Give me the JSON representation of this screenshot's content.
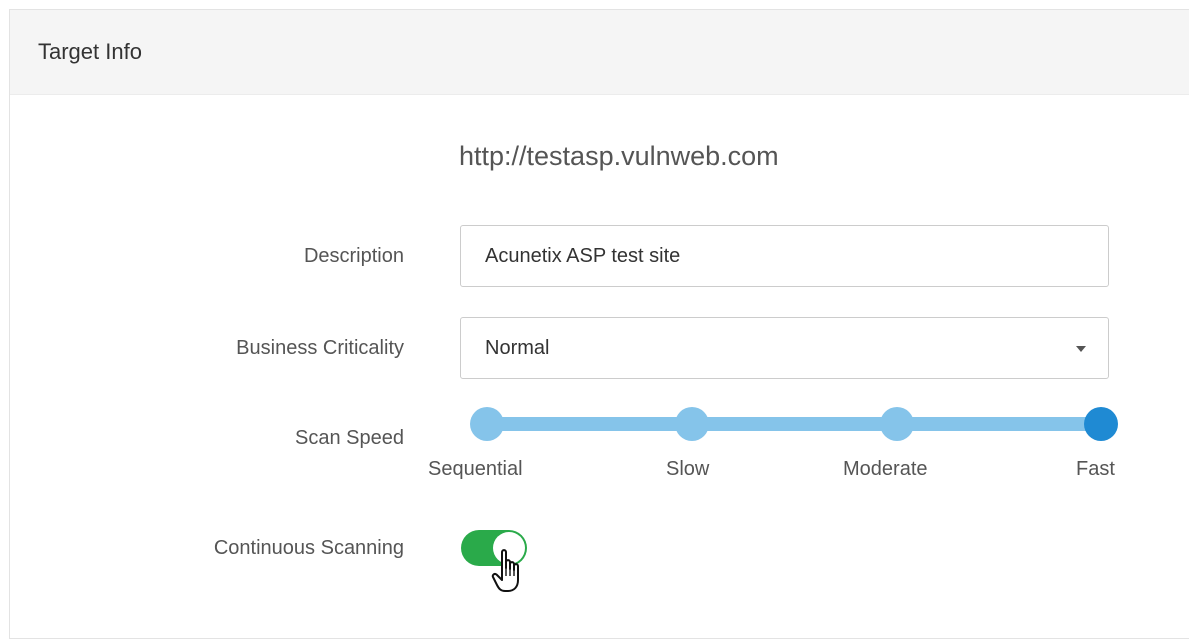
{
  "panel": {
    "title": "Target Info"
  },
  "target": {
    "url": "http://testasp.vulnweb.com"
  },
  "form": {
    "description": {
      "label": "Description",
      "value": "Acunetix ASP test site"
    },
    "business_criticality": {
      "label": "Business Criticality",
      "selected": "Normal"
    },
    "scan_speed": {
      "label": "Scan Speed",
      "options": [
        "Sequential",
        "Slow",
        "Moderate",
        "Fast"
      ],
      "selected": "Fast"
    },
    "continuous_scanning": {
      "label": "Continuous Scanning",
      "enabled": true
    }
  },
  "colors": {
    "slider_track": "#85c4ea",
    "slider_active": "#1f8ad3",
    "toggle_on": "#2aaa4a"
  },
  "icons": {
    "dropdown": "chevron-down-icon",
    "pointer": "hand-pointer-icon"
  }
}
